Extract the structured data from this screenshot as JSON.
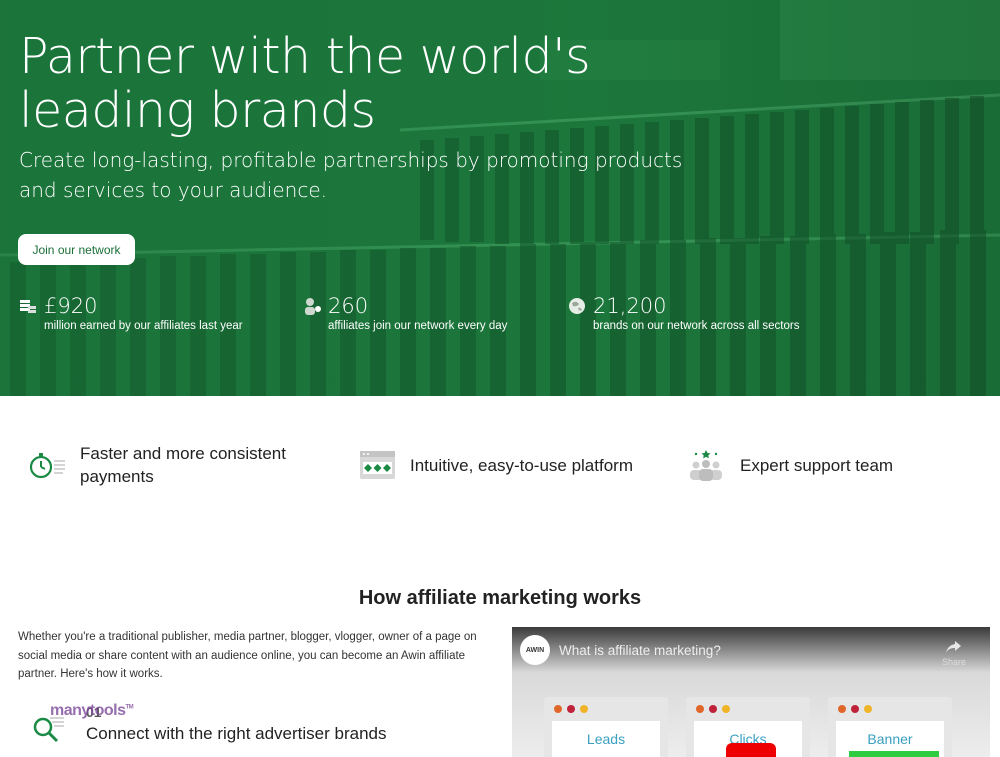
{
  "hero": {
    "title": "Partner with the world's leading brands",
    "subtitle": "Create long-lasting, profitable partnerships by promoting products and services to your audience.",
    "cta_label": "Join our network",
    "stats": [
      {
        "icon": "coins-icon",
        "value": "£920",
        "label": "million earned by our affiliates last year"
      },
      {
        "icon": "person-plus-icon",
        "value": "260",
        "label": "affiliates join our network every day"
      },
      {
        "icon": "globe-icon",
        "value": "21,200",
        "label": "brands on our network across all sectors"
      }
    ]
  },
  "features": [
    {
      "icon": "stopwatch-icon",
      "label": "Faster and more consistent payments"
    },
    {
      "icon": "dashboard-icon",
      "label": "Intuitive, easy-to-use platform"
    },
    {
      "icon": "support-team-icon",
      "label": "Expert support team"
    }
  ],
  "how": {
    "title": "How affiliate marketing works",
    "text": "Whether you're a traditional publisher, media partner, blogger, vlogger, owner of a page on social media or share content with an audience online, you can become an Awin affiliate partner. Here's how it works.",
    "step_number": "01",
    "step_title": "Connect with the right advertiser brands",
    "watermark": "manytools",
    "watermark_tm": "TM"
  },
  "video": {
    "logo_text": "AWIN",
    "title": "What is affiliate marketing?",
    "share_label": "Share",
    "cards": [
      "Leads",
      "Clicks",
      "Banner"
    ]
  },
  "colors": {
    "brand_green": "#1a6f37",
    "hero_overlay": "#1f7a3e",
    "icon_green": "#1a8a45"
  }
}
